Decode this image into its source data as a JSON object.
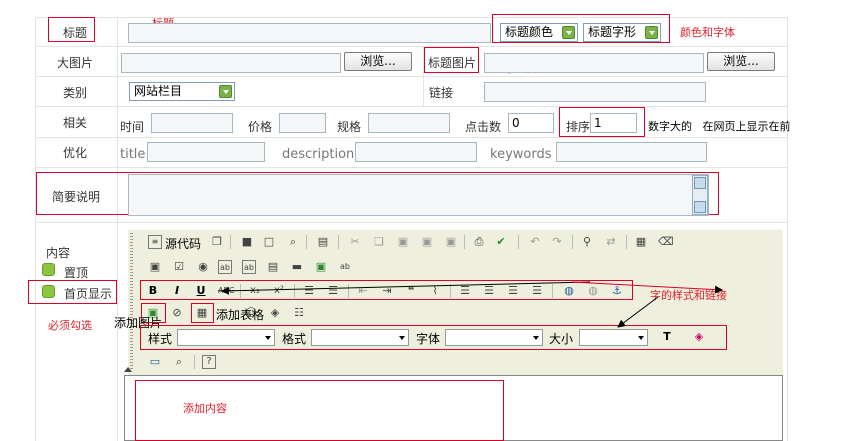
{
  "rows": {
    "title_label": "标题",
    "big_image_label": "大图片",
    "category_label": "类别",
    "related_label": "相关",
    "optimize_label": "优化",
    "summary_label": "简要说明",
    "content_label": "内容"
  },
  "title_row": {
    "title_color_option": "标题颜色",
    "title_font_option": "标题字形"
  },
  "image_row": {
    "browse_label": "浏览...",
    "title_image_label": "标题图片",
    "browse2_label": "浏览..."
  },
  "category_row": {
    "category_value": "网站栏目",
    "link_label": "链接"
  },
  "related_row": {
    "time_label": "时间",
    "price_label": "价格",
    "spec_label": "规格",
    "clicks_label": "点击数",
    "clicks_value": "0",
    "sort_label": "排序",
    "sort_value": "1"
  },
  "seo_row": {
    "title_label": "title",
    "description_label": "description",
    "keywords_label": "keywords"
  },
  "content_side": {
    "pin_label": "置顶",
    "home_label": "首页显示"
  },
  "editor": {
    "source_label": "源代码",
    "style_label": "样式",
    "format_label": "格式",
    "font_label": "字体",
    "size_label": "大小"
  },
  "annotations": {
    "title": "标题",
    "color_font": "颜色和字体",
    "small_image": "小图片",
    "sort_note": "数字大的   在网页上显示在前",
    "text_style_link": "字的样式和链接",
    "must_check": "必须勾选",
    "add_image": "添加图片",
    "add_table": "添加表格",
    "add_content": "添加内容"
  },
  "colors": {
    "annotation_red": "#d9002a",
    "toolbar_bg": "#efefde",
    "dropdown_green": "#7bb34a"
  }
}
